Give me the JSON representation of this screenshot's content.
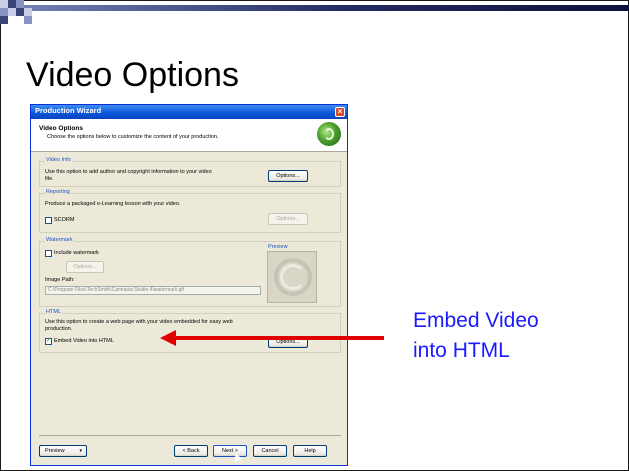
{
  "slide": {
    "title": "Video Options",
    "callout": [
      "Embed Video",
      "into HTML"
    ],
    "colors": {
      "callout_text": "#1a1aff",
      "arrow": "#e00000"
    }
  },
  "wizard": {
    "window_title": "Production Wizard",
    "header_title": "Video Options",
    "header_subtitle": "Choose the options below to customize the content of your production.",
    "video_info": {
      "label": "Video Info",
      "description": "Use this option to add author and copyright information to your video file.",
      "options_button": "Options..."
    },
    "reporting": {
      "label": "Reporting",
      "description": "Produce a packaged e-Learning lesson with your video.",
      "scorm_label": "SCORM",
      "options_button": "Options..."
    },
    "watermark": {
      "label": "Watermark",
      "include_label": "Include watermark",
      "options_button": "Options...",
      "image_path_label": "Image Path:",
      "image_path_value": "C:\\Program Files\\TechSmith\\Camtasia Studio 4\\watermark.gif",
      "preview_label": "Preview"
    },
    "html": {
      "label": "HTML",
      "description": "Use this option to create a web page with your video embedded for easy web production.",
      "embed_label": "Embed Video into HTML",
      "embed_checked": true,
      "options_button": "Options..."
    },
    "footer": {
      "preview_button": "Preview",
      "back_button": "< Back",
      "next_button": "Next >",
      "cancel_button": "Cancel",
      "help_button": "Help"
    }
  }
}
